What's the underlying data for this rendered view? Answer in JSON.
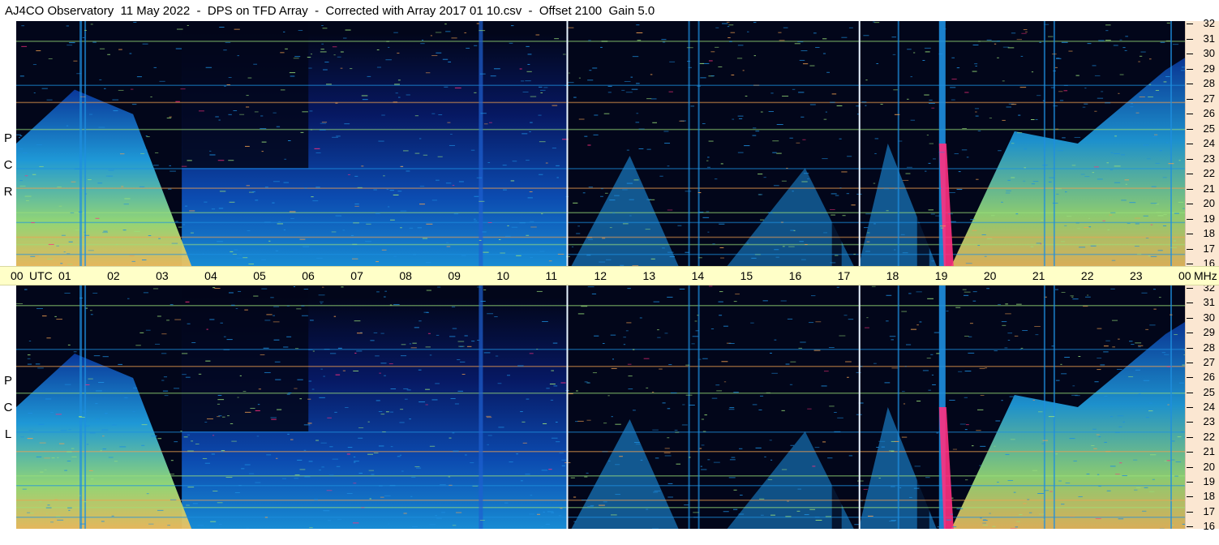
{
  "title": "AJ4CO Observatory  11 May 2022  -  DPS on TFD Array  -  Corrected with Array 2017 01 10.csv  -  Offset 2100  Gain 5.0",
  "panels": [
    {
      "label_letters": [
        "R",
        "C",
        "P"
      ]
    },
    {
      "label_letters": [
        "L",
        "C",
        "P"
      ]
    }
  ],
  "time_axis": {
    "labels": [
      "00",
      "UTC",
      "01",
      "02",
      "03",
      "04",
      "05",
      "06",
      "07",
      "08",
      "09",
      "10",
      "11",
      "12",
      "13",
      "14",
      "15",
      "16",
      "17",
      "18",
      "19",
      "20",
      "21",
      "22",
      "23",
      "00",
      "MHz"
    ]
  },
  "freq_axis": {
    "labels": [
      "32",
      "31",
      "30",
      "29",
      "28",
      "27",
      "26",
      "25",
      "24",
      "23",
      "22",
      "21",
      "20",
      "19",
      "18",
      "17",
      "16"
    ]
  },
  "colors": {
    "background": "#02061a",
    "low": "#0a2a9a",
    "mid": "#1e8fe0",
    "high": "#9ae07a",
    "peak": "#f0a050",
    "burst": "#ff3080",
    "marker_line": "#e8f4ff",
    "time_axis_bg": "#ffffc8",
    "freq_axis_bg": "#fbe7d2"
  },
  "chart_data": {
    "type": "heatmap",
    "title": "AJ4CO Observatory  11 May 2022  -  DPS on TFD Array  -  Corrected with Array 2017 01 10.csv  -  Offset 2100  Gain 5.0",
    "x_unit": "UTC",
    "y_unit": "MHz",
    "xlim": [
      0,
      24
    ],
    "ylim": [
      16,
      32
    ],
    "x_ticks": [
      "00",
      "01",
      "02",
      "03",
      "04",
      "05",
      "06",
      "07",
      "08",
      "09",
      "10",
      "11",
      "12",
      "13",
      "14",
      "15",
      "16",
      "17",
      "18",
      "19",
      "20",
      "21",
      "22",
      "23",
      "00"
    ],
    "y_ticks": [
      32,
      31,
      30,
      29,
      28,
      27,
      26,
      25,
      24,
      23,
      22,
      21,
      20,
      19,
      18,
      17,
      16
    ],
    "panels": [
      "RCP",
      "LCP"
    ],
    "marker_lines_utc": [
      11.3,
      17.3
    ]
  }
}
